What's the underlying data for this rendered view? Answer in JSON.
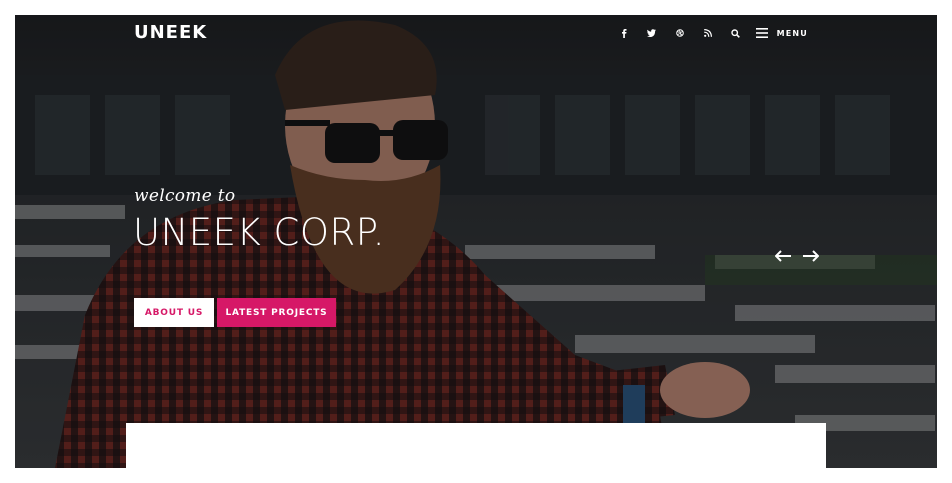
{
  "brand": {
    "logo": "UNEEK"
  },
  "nav": {
    "icons": [
      "facebook-icon",
      "twitter-icon",
      "dribbble-icon",
      "rss-icon",
      "search-icon"
    ],
    "menu_label": "MENU"
  },
  "hero": {
    "welcome": "welcome to",
    "headline": "UNEEK CORP.",
    "buttons": {
      "about": "ABOUT US",
      "projects": "LATEST PROJECTS"
    }
  },
  "colors": {
    "accent": "#d61867",
    "text_on_dark": "#ffffff"
  }
}
